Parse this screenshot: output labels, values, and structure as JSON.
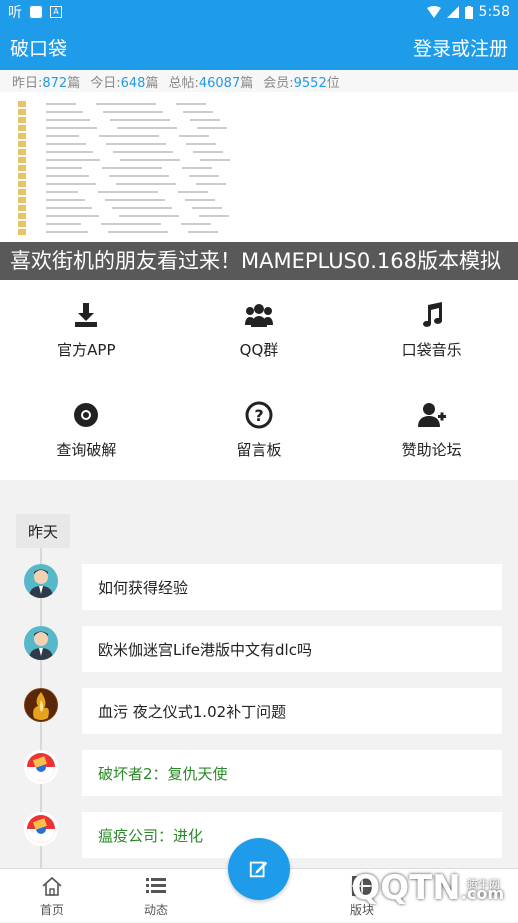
{
  "statusbar": {
    "left_text": "听",
    "time": "5:58"
  },
  "appbar": {
    "title": "破口袋",
    "login": "登录或注册"
  },
  "stats": {
    "yesterday_label": "昨日:",
    "yesterday": "872",
    "yesterday_unit": "篇",
    "today_label": "今日:",
    "today": "648",
    "today_unit": "篇",
    "total_label": "总帖:",
    "total": "46087",
    "total_unit": "篇",
    "members_label": "会员:",
    "members": "9552",
    "members_unit": "位"
  },
  "banner": {
    "caption": "喜欢街机的朋友看过来！MAMEPLUS0.168版本模拟"
  },
  "grid": [
    {
      "label": "官方APP",
      "icon": "download-icon"
    },
    {
      "label": "QQ群",
      "icon": "group-icon"
    },
    {
      "label": "口袋音乐",
      "icon": "music-icon"
    },
    {
      "label": "查询破解",
      "icon": "lifebuoy-icon"
    },
    {
      "label": "留言板",
      "icon": "question-icon"
    },
    {
      "label": "赞助论坛",
      "icon": "add-user-icon"
    }
  ],
  "feed": {
    "day": "昨天",
    "posts": [
      {
        "title": "如何获得经验",
        "avatar": "man-avatar"
      },
      {
        "title": "欧米伽迷宫Life港版中文有dlc吗",
        "avatar": "man-avatar"
      },
      {
        "title": "血污 夜之仪式1.02补丁问题",
        "avatar": "fire-avatar"
      },
      {
        "title": "破坏者2：复仇天使",
        "avatar": "pokeball-avatar"
      },
      {
        "title": "瘟疫公司：进化",
        "avatar": "pokeball-avatar"
      }
    ]
  },
  "tabs": [
    {
      "label": "首页",
      "icon": "home-icon"
    },
    {
      "label": "动态",
      "icon": "list-icon"
    },
    {
      "label": "版块",
      "icon": "grid-icon"
    }
  ],
  "watermark": {
    "main": "QQTN",
    "sub": "腾牛网",
    "suffix": ".com"
  },
  "colors": {
    "accent": "#1e9be9",
    "green_post": "#2a8a2a"
  }
}
